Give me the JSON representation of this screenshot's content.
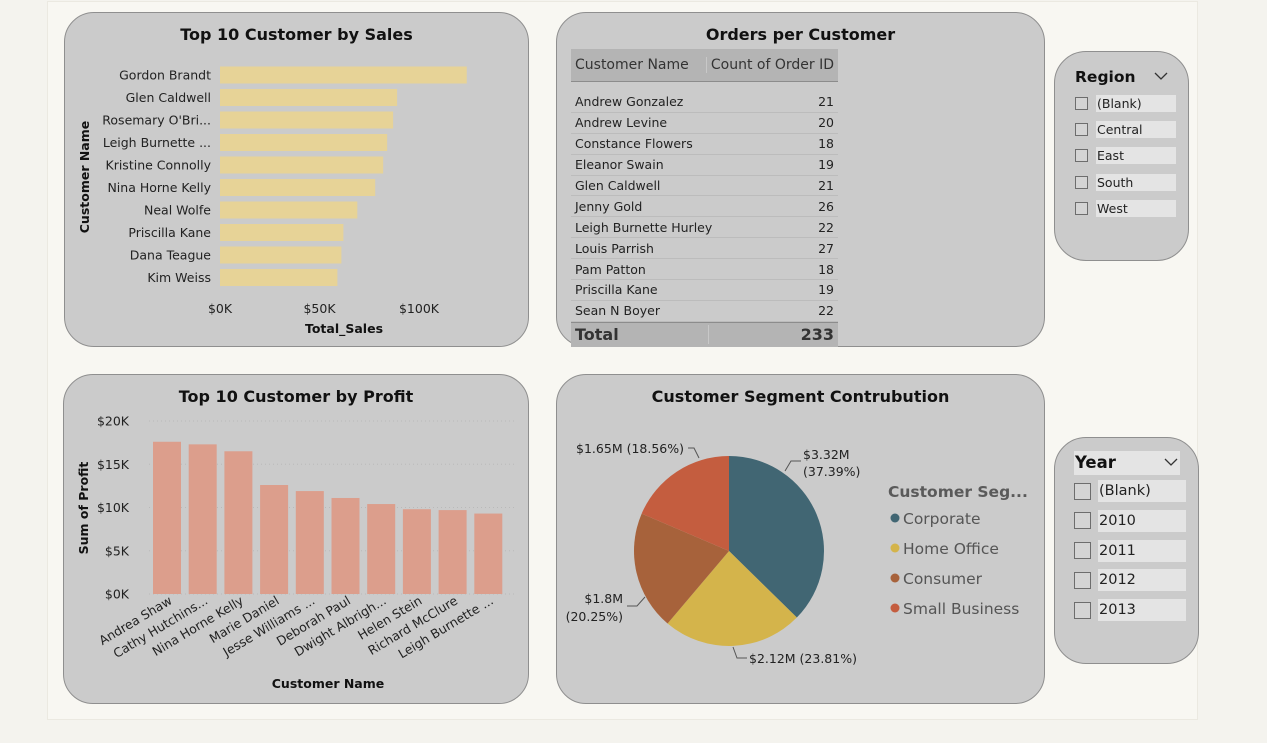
{
  "colors": {
    "page_bg": "#f4f3ee",
    "card_bg": "#cbcbcb",
    "sales_bar": "#e7d397",
    "profit_bar": "#dc9e8c",
    "corporate": "#416673",
    "home_office": "#d4b44b",
    "consumer": "#a7623b",
    "small_business": "#c45d3f"
  },
  "sales_chart": {
    "title": "Top 10 Customer by Sales"
  },
  "orders_table": {
    "title": "Orders per Customer",
    "headers": [
      "Customer Name",
      "Count of Order ID"
    ],
    "rows": [
      {
        "name": "Andrew Gonzalez",
        "count": "21"
      },
      {
        "name": "Andrew Levine",
        "count": "20"
      },
      {
        "name": "Constance Flowers",
        "count": "18"
      },
      {
        "name": "Eleanor Swain",
        "count": "19"
      },
      {
        "name": "Glen Caldwell",
        "count": "21"
      },
      {
        "name": "Jenny Gold",
        "count": "26"
      },
      {
        "name": "Leigh Burnette Hurley",
        "count": "22"
      },
      {
        "name": "Louis Parrish",
        "count": "27"
      },
      {
        "name": "Pam Patton",
        "count": "18"
      },
      {
        "name": "Priscilla Kane",
        "count": "19"
      },
      {
        "name": "Sean N Boyer",
        "count": "22"
      }
    ],
    "total_label": "Total",
    "total_value": "233"
  },
  "region_slicer": {
    "title": "Region",
    "options": [
      "(Blank)",
      "Central",
      "East",
      "South",
      "West"
    ]
  },
  "profit_chart": {
    "title": "Top 10 Customer by Profit"
  },
  "segment_chart": {
    "title": "Customer Segment Contrubution"
  },
  "year_slicer": {
    "title": "Year",
    "options": [
      "(Blank)",
      "2010",
      "2011",
      "2012",
      "2013"
    ]
  },
  "chart_data": [
    {
      "type": "bar",
      "orientation": "horizontal",
      "title": "Top 10 Customer by Sales",
      "categories": [
        "Gordon Brandt",
        "Glen Caldwell",
        "Rosemary O'Bri...",
        "Leigh Burnette ...",
        "Kristine Connolly",
        "Nina Horne Kelly",
        "Neal Wolfe",
        "Priscilla Kane",
        "Dana Teague",
        "Kim Weiss"
      ],
      "values": [
        124000,
        89000,
        87000,
        84000,
        82000,
        78000,
        69000,
        62000,
        61000,
        59000
      ],
      "xlabel": "Total_Sales",
      "ylabel": "Customer Name",
      "xlim": [
        0,
        125000
      ],
      "ticks": [
        0,
        50000,
        100000
      ],
      "tick_labels": [
        "$0K",
        "$50K",
        "$100K"
      ],
      "grid": false
    },
    {
      "type": "bar",
      "orientation": "vertical",
      "title": "Top 10 Customer by Profit",
      "categories": [
        "Andrea Shaw",
        "Cathy Hutchins...",
        "Nina Horne Kelly",
        "Marie Daniel",
        "Jesse Williams ...",
        "Deborah Paul",
        "Dwight Albrigh...",
        "Helen Stein",
        "Richard McClure",
        "Leigh Burnette ..."
      ],
      "values": [
        17600,
        17300,
        16500,
        12600,
        11900,
        11100,
        10400,
        9800,
        9700,
        9300
      ],
      "xlabel": "Customer Name",
      "ylabel": "Sum of Profit",
      "ylim": [
        0,
        20000
      ],
      "ticks": [
        0,
        5000,
        10000,
        15000,
        20000
      ],
      "tick_labels": [
        "$0K",
        "$5K",
        "$10K",
        "$15K",
        "$20K"
      ],
      "grid": true
    },
    {
      "type": "pie",
      "title": "Customer Segment Contrubution",
      "legend_title": "Customer Seg...",
      "legend_position": "right",
      "slices": [
        {
          "name": "Corporate",
          "value": 3.32,
          "label": "$3.32M",
          "pct_label": "(37.39%)"
        },
        {
          "name": "Home Office",
          "value": 2.12,
          "label": "$2.12M (23.81%)",
          "pct_label": ""
        },
        {
          "name": "Consumer",
          "value": 1.8,
          "label": "$1.8M",
          "pct_label": "(20.25%)"
        },
        {
          "name": "Small Business",
          "value": 1.65,
          "label": "$1.65M (18.56%)",
          "pct_label": ""
        }
      ]
    }
  ]
}
